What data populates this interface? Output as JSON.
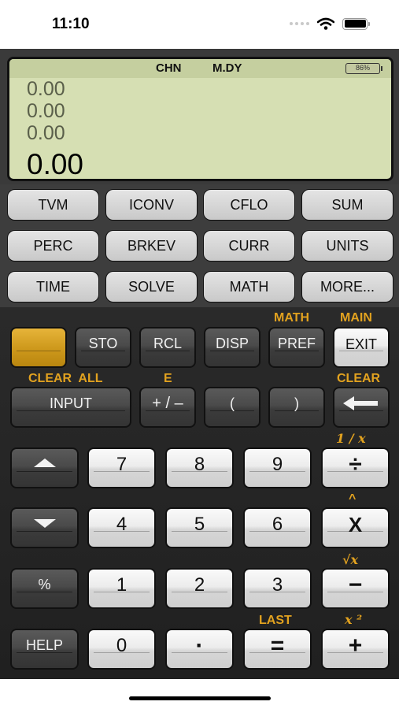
{
  "status": {
    "time": "11:10"
  },
  "display": {
    "indicators": {
      "mode": "CHN",
      "date_format": "M.DY"
    },
    "battery": "86%",
    "stack": [
      "0.00",
      "0.00",
      "0.00"
    ],
    "main": "0.00"
  },
  "menu": [
    "TVM",
    "ICONV",
    "CFLO",
    "SUM",
    "PERC",
    "BRKEV",
    "CURR",
    "UNITS",
    "TIME",
    "SOLVE",
    "MATH",
    "MORE..."
  ],
  "keys": {
    "sto": "STO",
    "rcl": "RCL",
    "disp": "DISP",
    "pref": "PREF",
    "exit": "EXIT",
    "input": "INPUT",
    "sign": "+ / –",
    "lparen": "(",
    "rparen": ")",
    "seven": "7",
    "eight": "8",
    "nine": "9",
    "divide": "÷",
    "four": "4",
    "five": "5",
    "six": "6",
    "multiply": "X",
    "percent": "%",
    "one": "1",
    "two": "2",
    "three": "3",
    "minus": "−",
    "help": "HELP",
    "zero": "0",
    "dot": "·",
    "equals": "=",
    "plus": "+"
  },
  "shift_labels": {
    "math": "MATH",
    "main": "MAIN",
    "clear_all": "CLEAR  ALL",
    "e": "E",
    "clear": "CLEAR",
    "reciprocal": "1 / x",
    "power": "^",
    "sqrt": "√x",
    "last": "LAST",
    "square": "x ²"
  },
  "colors": {
    "accent": "#e2a21f",
    "lcd": "#d6dfb3",
    "shift_key": "#cf9a1d"
  }
}
